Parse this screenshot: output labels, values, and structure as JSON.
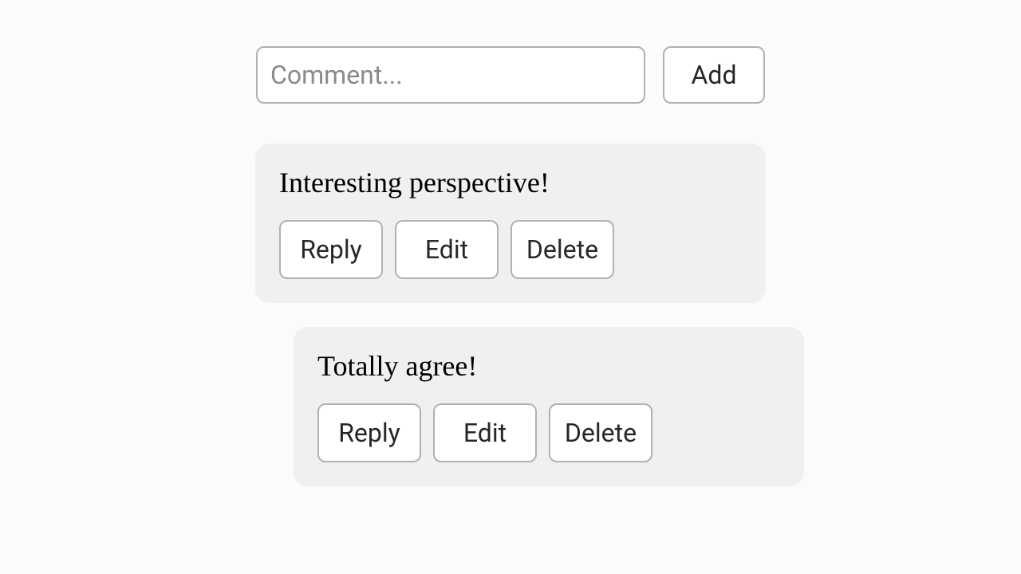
{
  "input": {
    "placeholder": "Comment...",
    "value": "",
    "add_label": "Add"
  },
  "action_labels": {
    "reply": "Reply",
    "edit": "Edit",
    "delete": "Delete"
  },
  "comments": [
    {
      "text": "Interesting perspective!",
      "level": 0
    },
    {
      "text": "Totally agree!",
      "level": 1
    }
  ]
}
